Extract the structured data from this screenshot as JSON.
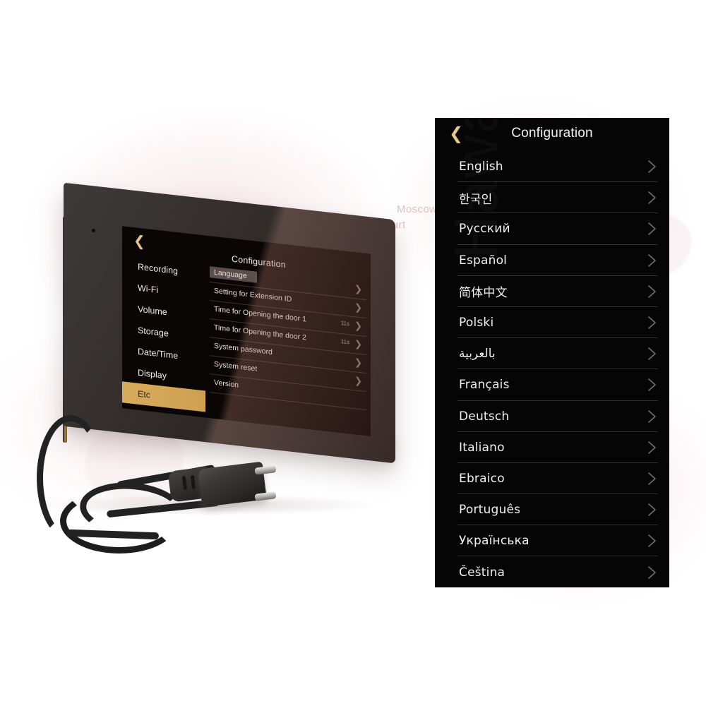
{
  "background": {
    "type": "product-photo-on-white",
    "map_city_labels": [
      "Moscow",
      "Frankfurt"
    ],
    "watermark_text": "Hawayway"
  },
  "device": {
    "name": "video-intercom-monitor",
    "screen": {
      "back_icon": "chevron-left-icon",
      "title": "Configuration",
      "sidebar": [
        {
          "label": "Recording",
          "active": false
        },
        {
          "label": "Wi-Fi",
          "active": false
        },
        {
          "label": "Volume",
          "active": false
        },
        {
          "label": "Storage",
          "active": false
        },
        {
          "label": "Date/Time",
          "active": false
        },
        {
          "label": "Display",
          "active": false
        },
        {
          "label": "Etc",
          "active": true
        }
      ],
      "rows": [
        {
          "label": "Language",
          "value": "",
          "selected": true
        },
        {
          "label": "Setting for Extension ID",
          "value": "",
          "selected": false
        },
        {
          "label": "Time for Opening the door 1",
          "value": "11s",
          "selected": false
        },
        {
          "label": "Time for Opening the door 2",
          "value": "11s",
          "selected": false
        },
        {
          "label": "System  password",
          "value": "",
          "selected": false
        },
        {
          "label": "System reset",
          "value": "",
          "selected": false
        },
        {
          "label": "Version",
          "value": "",
          "selected": false
        }
      ],
      "row_chevron_icon": "chevron-right-icon"
    },
    "accessory": "eu-power-cable-with-plug"
  },
  "panel": {
    "header": {
      "back_icon": "chevron-left-icon",
      "back_icon_color": "#e8c68a",
      "title": "Configuration"
    },
    "row_chevron_icon": "chevron-right-icon",
    "background_color": "#050505",
    "text_color": "#f0f0f0",
    "languages": [
      {
        "label": "English"
      },
      {
        "label": "한국인"
      },
      {
        "label": "Русский"
      },
      {
        "label": "Español"
      },
      {
        "label": "简体中文"
      },
      {
        "label": "Polski"
      },
      {
        "label": "بالعربية"
      },
      {
        "label": "Français"
      },
      {
        "label": "Deutsch"
      },
      {
        "label": "Italiano"
      },
      {
        "label": "Ebraico"
      },
      {
        "label": "Português"
      },
      {
        "label": "Українська"
      },
      {
        "label": "Čeština"
      }
    ]
  }
}
